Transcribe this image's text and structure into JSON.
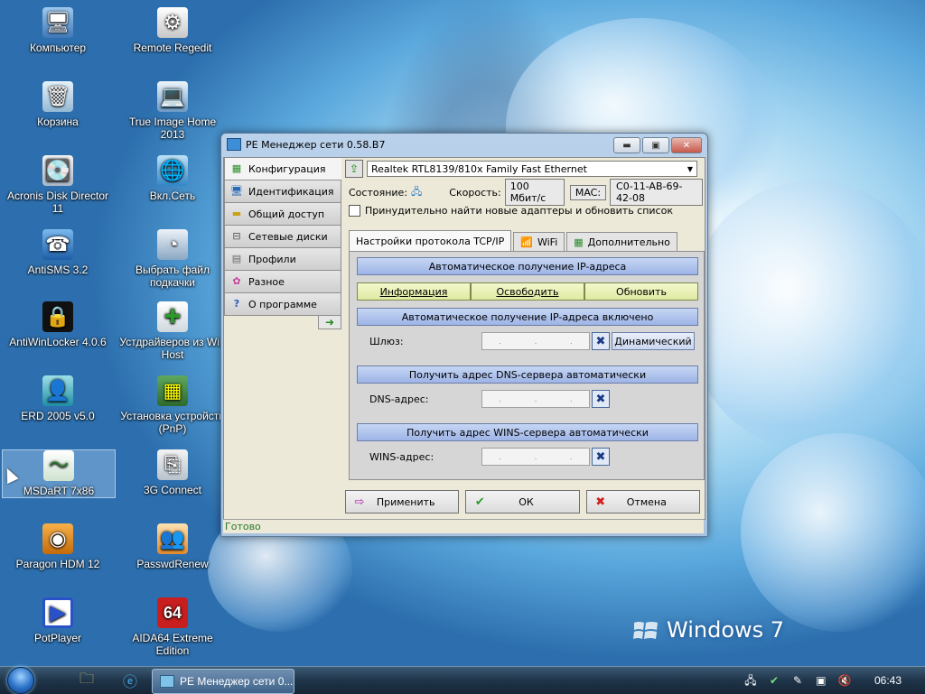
{
  "desktop": {
    "icons": [
      {
        "label": "Компьютер",
        "icon": "computer-icon"
      },
      {
        "label": "Remote Regedit",
        "icon": "regedit-icon"
      },
      {
        "label": "Корзина",
        "icon": "recycle-bin-icon"
      },
      {
        "label": "True Image Home 2013",
        "icon": "true-image-icon"
      },
      {
        "label": "Acronis Disk Director 11",
        "icon": "disk-director-icon"
      },
      {
        "label": "Вкл.Сеть",
        "icon": "network-globe-icon"
      },
      {
        "label": "AntiSMS 3.2",
        "icon": "antisms-icon"
      },
      {
        "label": "Выбрать файл подкачки",
        "icon": "pagefile-icon"
      },
      {
        "label": "AntiWinLocker 4.0.6",
        "icon": "lock-icon"
      },
      {
        "label": "Устдрайверов из Win Host",
        "icon": "driver-install-icon"
      },
      {
        "label": "ERD 2005 v5.0",
        "icon": "erd-icon"
      },
      {
        "label": "Установка устройств (PnP)",
        "icon": "pnp-device-icon"
      },
      {
        "label": "MSDaRT 7x86",
        "icon": "msdart-icon"
      },
      {
        "label": "3G Connect",
        "icon": "usb-modem-icon"
      },
      {
        "label": "Paragon HDM 12",
        "icon": "paragon-icon"
      },
      {
        "label": "PasswdRenew",
        "icon": "users-icon"
      },
      {
        "label": "PotPlayer",
        "icon": "potplayer-icon"
      },
      {
        "label": "AIDA64 Extreme Edition",
        "icon": "aida64-icon"
      }
    ],
    "watermark": {
      "text": "Windows",
      "version": "7"
    }
  },
  "taskbar": {
    "active_task": "PE Менеджер сети 0...",
    "clock": "06:43",
    "tray_icons": [
      "network-tray-icon",
      "shield-check-icon",
      "pen-icon",
      "monitor-tray-icon",
      "volume-muted-icon"
    ]
  },
  "window": {
    "title": "PE Менеджер сети 0.58.B7",
    "sidebar": [
      {
        "label": "Конфигурация",
        "icon": "network-card-icon"
      },
      {
        "label": "Идентификация",
        "icon": "computer-id-icon"
      },
      {
        "label": "Общий доступ",
        "icon": "share-folder-icon"
      },
      {
        "label": "Сетевые диски",
        "icon": "network-drive-icon"
      },
      {
        "label": "Профили",
        "icon": "profile-icon"
      },
      {
        "label": "Разное",
        "icon": "misc-icon"
      },
      {
        "label": "О программе",
        "icon": "help-icon"
      }
    ],
    "adapter": "Realtek RTL8139/810x Family Fast Ethernet",
    "status_label": "Состояние:",
    "speed_label": "Скорость:",
    "speed_value": "100 Мбит/с",
    "mac_label": "MAC:",
    "mac_value": "C0-11-AB-69-42-08",
    "force_find_label": "Принудительно найти новые адаптеры и обновить список",
    "tabs": [
      {
        "label": "Настройки протокола TCP/IP",
        "icon": ""
      },
      {
        "label": "WiFi",
        "icon": "wifi-icon"
      },
      {
        "label": "Дополнительно",
        "icon": "extra-icon"
      }
    ],
    "tcpip": {
      "auto_ip": "Автоматическое получение IP-адреса",
      "btn_info": "Информация",
      "btn_release": "Освободить",
      "btn_renew": "Обновить",
      "auto_ip_on": "Автоматическое получение IP-адреса включено",
      "gateway_label": "Шлюз:",
      "dynamic_btn": "Динамический",
      "dns_auto": "Получить адрес DNS-сервера автоматически",
      "dns_label": "DNS-адрес:",
      "wins_auto": "Получить адрес WINS-сервера автоматически",
      "wins_label": "WINS-адрес:"
    },
    "actions": {
      "apply": "Применить",
      "ok": "ОК",
      "cancel": "Отмена"
    },
    "status_bar": "Готово"
  }
}
